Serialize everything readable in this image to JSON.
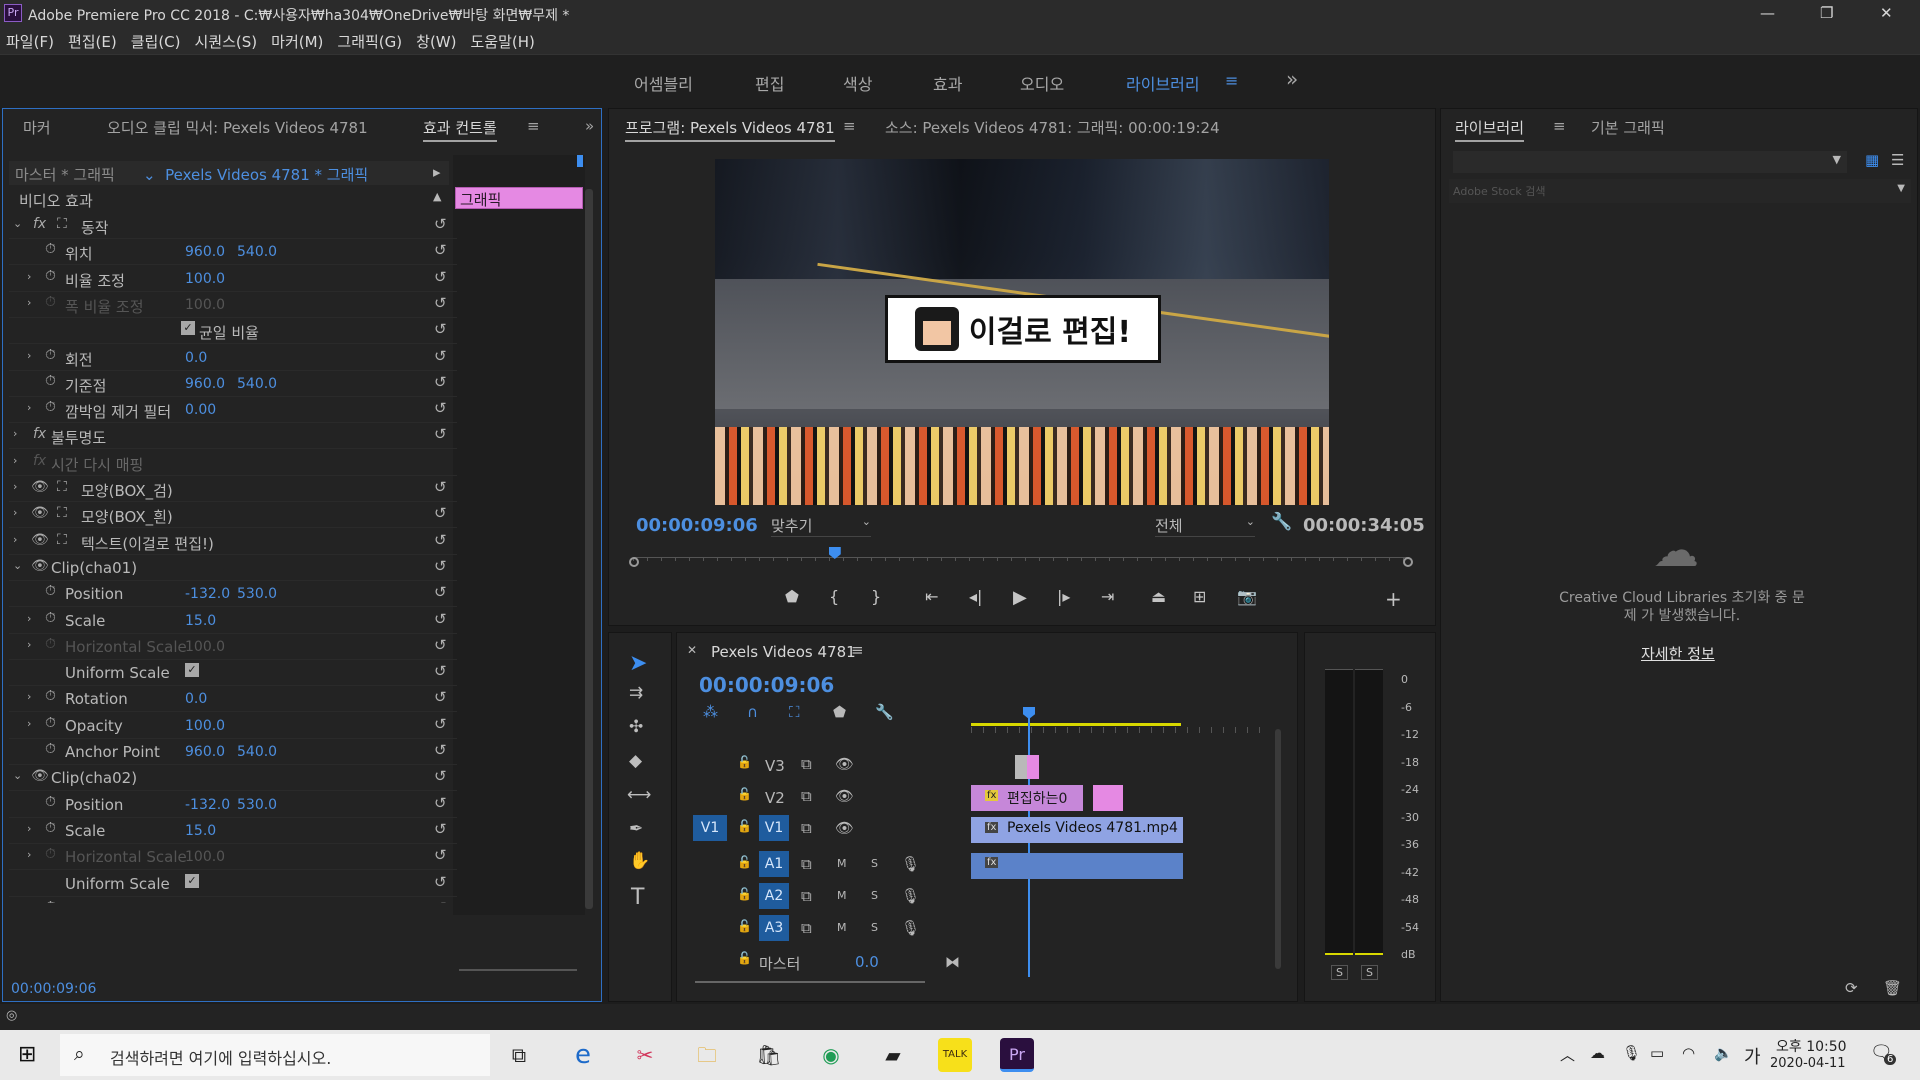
{
  "title_bar": {
    "app_icon": "Pr",
    "title": "Adobe Premiere Pro CC 2018 - C:₩사용자₩ha304₩OneDrive₩바탕 화면₩무제 *",
    "minimize": "—",
    "maximize": "❐",
    "close": "✕"
  },
  "menu": [
    "파일(F)",
    "편집(E)",
    "클립(C)",
    "시퀀스(S)",
    "마커(M)",
    "그래픽(G)",
    "창(W)",
    "도움말(H)"
  ],
  "workspaces": {
    "items": [
      "어셈블리",
      "편집",
      "색상",
      "효과",
      "오디오",
      "라이브러리"
    ],
    "active": "라이브러리",
    "more": "»"
  },
  "left_panel": {
    "tabs": [
      "마커",
      "오디오 클립 믹서: Pexels Videos 4781",
      "효과 컨트롤"
    ],
    "master_label": "마스터 * 그래픽",
    "clip_label": "Pexels Videos 4781 * 그래픽",
    "video_effects": "비디오 효과",
    "graphic_clip": "그래픽",
    "rows": [
      {
        "label": "동작",
        "type": "fx"
      },
      {
        "label": "위치",
        "v1": "960.0",
        "v2": "540.0"
      },
      {
        "label": "비율 조정",
        "v1": "100.0"
      },
      {
        "label": "폭 비율 조정",
        "v1": "100.0",
        "dim": true
      },
      {
        "label": "균일 비율",
        "check": true
      },
      {
        "label": "회전",
        "v1": "0.0"
      },
      {
        "label": "기준점",
        "v1": "960.0",
        "v2": "540.0"
      },
      {
        "label": "깜박임 제거 필터",
        "v1": "0.00"
      },
      {
        "label": "불투명도",
        "type": "fx"
      },
      {
        "label": "시간 다시 매핑",
        "type": "fx",
        "dim": true
      },
      {
        "label": "모양(BOX_검)",
        "type": "layer"
      },
      {
        "label": "모양(BOX_흰)",
        "type": "layer"
      },
      {
        "label": "텍스트(이걸로 편집!)",
        "type": "layer"
      },
      {
        "label": "Clip(cha01)",
        "type": "clip"
      },
      {
        "label": "Position",
        "v1": "-132.0",
        "v2": "530.0"
      },
      {
        "label": "Scale",
        "v1": "15.0"
      },
      {
        "label": "Horizontal Scale",
        "v1": "100.0",
        "dim": true
      },
      {
        "label": "Uniform Scale",
        "check": true
      },
      {
        "label": "Rotation",
        "v1": "0.0"
      },
      {
        "label": "Opacity",
        "v1": "100.0"
      },
      {
        "label": "Anchor Point",
        "v1": "960.0",
        "v2": "540.0"
      },
      {
        "label": "Clip(cha02)",
        "type": "clip"
      },
      {
        "label": "Position",
        "v1": "-132.0",
        "v2": "530.0"
      },
      {
        "label": "Scale",
        "v1": "15.0"
      },
      {
        "label": "Horizontal Scale",
        "v1": "100.0",
        "dim": true
      },
      {
        "label": "Uniform Scale",
        "check": true
      },
      {
        "label": "Rotation",
        "v1": "0.0"
      },
      {
        "label": "Opacity",
        "v1": "100.0"
      },
      {
        "label": "Anchor Point",
        "v1": "960.0",
        "v2": "540.0"
      }
    ],
    "timecode": "00:00:09:06"
  },
  "program": {
    "tabs": [
      "프로그램: Pexels Videos 4781",
      "소스: Pexels Videos 4781: 그래픽: 00:00:19:24"
    ],
    "overlay_text": "이걸로 편집!",
    "timecode": "00:00:09:06",
    "fit": "맞추기",
    "quality": "전체",
    "duration": "00:00:34:05",
    "playhead_fraction": 0.26
  },
  "library": {
    "tabs": [
      "라이브러리",
      "기본 그래픽"
    ],
    "search_placeholder": "Adobe Stock 검색",
    "error": "Creative Cloud Libraries 초기화 중 문제 가 발생했습니다.",
    "more_info": "자세한 정보"
  },
  "timeline": {
    "title": "Pexels Videos 4781",
    "timecode": "00:00:09:06",
    "tracks": [
      {
        "name": "V3"
      },
      {
        "name": "V2"
      },
      {
        "name": "V1",
        "src": "V1"
      },
      {
        "name": "A1"
      },
      {
        "name": "A2"
      },
      {
        "name": "A3"
      }
    ],
    "master_label": "마스터",
    "master_value": "0.0",
    "m": "M",
    "s": "S",
    "clips": {
      "v2": "편집하는0",
      "v1": "Pexels Videos 4781.mp4 [V]"
    }
  },
  "meter": {
    "ticks": [
      "0",
      "-6",
      "-12",
      "-18",
      "-24",
      "-30",
      "-36",
      "-42",
      "-48",
      "-54",
      "dB"
    ],
    "solo": "S"
  },
  "taskbar": {
    "search": "검색하려면 여기에 입력하십시오.",
    "time": "오후 10:50",
    "date": "2020-04-11",
    "ime": "가",
    "notif": "6"
  }
}
